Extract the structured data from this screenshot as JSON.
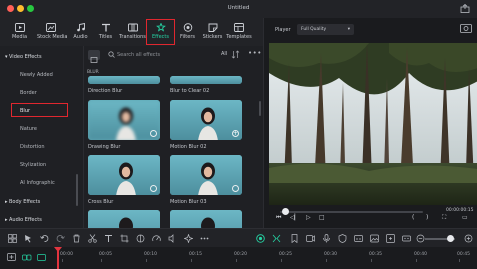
{
  "window": {
    "title": "Untitled"
  },
  "toolbar": {
    "items": [
      {
        "label": "Media",
        "icon": "media-icon"
      },
      {
        "label": "Stock Media",
        "icon": "stock-media-icon"
      },
      {
        "label": "Audio",
        "icon": "audio-icon"
      },
      {
        "label": "Titles",
        "icon": "titles-icon"
      },
      {
        "label": "Transitions",
        "icon": "transitions-icon"
      },
      {
        "label": "Effects",
        "icon": "effects-icon",
        "active": true
      },
      {
        "label": "Filters",
        "icon": "filters-icon"
      },
      {
        "label": "Stickers",
        "icon": "stickers-icon"
      },
      {
        "label": "Templates",
        "icon": "templates-icon"
      }
    ],
    "active_color": "#25d4a4",
    "highlight_color": "#e0272f"
  },
  "sidebar": {
    "items": [
      {
        "label": "Video Effects",
        "header": true
      },
      {
        "label": "Newly Added"
      },
      {
        "label": "Border"
      },
      {
        "label": "Blur",
        "selected": true
      },
      {
        "label": "Nature"
      },
      {
        "label": "Distortion"
      },
      {
        "label": "Stylization"
      },
      {
        "label": "AI Infographic"
      },
      {
        "label": "Body Effects",
        "header": true
      },
      {
        "label": "Audio Effects",
        "header": true
      }
    ]
  },
  "effects_panel": {
    "search_placeholder": "Search all effects",
    "filter_all": "All",
    "section_label": "BLUR",
    "cards": [
      {
        "label": "Direction Blur",
        "badge": "plus"
      },
      {
        "label": "Blur to Clear 02",
        "badge": "download"
      },
      {
        "label": "Drawing Blur",
        "badge": "download"
      },
      {
        "label": "Motion Blur 02",
        "badge": "plus"
      },
      {
        "label": "Cross Blur",
        "badge": "download"
      },
      {
        "label": "Motion Blur 03",
        "badge": "download"
      }
    ]
  },
  "player": {
    "label": "Player",
    "quality": "Full Quality",
    "timecode": "00:00:00:15",
    "progress": 0.02
  },
  "timeline": {
    "ruler_ticks": [
      "00:00",
      "00:05",
      "00:10",
      "00:15",
      "00:20",
      "00:25",
      "00:30",
      "00:35",
      "00:40",
      "00:45"
    ]
  }
}
